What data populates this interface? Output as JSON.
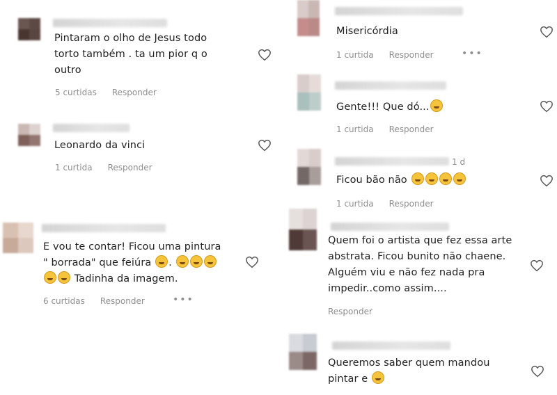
{
  "colors": {
    "meta": "#8e8e8e",
    "text": "#262626",
    "emoji": "#f5c43b"
  },
  "icons": {
    "like": "heart-icon",
    "more": "more-options-icon"
  },
  "left_comments": [
    {
      "lines": [
        "Pintaram o olho de Jesus todo",
        "torto também . ta um pior q o",
        "outro"
      ],
      "likes": "5 curtidas",
      "reply": "Responder"
    },
    {
      "lines": [
        "Leonardo da vinci"
      ],
      "likes": "1 curtida",
      "reply": "Responder"
    },
    {
      "lines": [
        "E vou te contar! Ficou uma pintura",
        "\" borrada\" que feiúra",
        "Tadinha da imagem."
      ],
      "likes": "6 curtidas",
      "reply": "Responder",
      "more": "•••"
    }
  ],
  "right_comments": [
    {
      "lines": [
        "Misericórdia"
      ],
      "likes": "1 curtida",
      "reply": "Responder",
      "more": "•••"
    },
    {
      "lines": [
        "Gente!!! Que dó..."
      ],
      "likes": "1 curtida",
      "reply": "Responder"
    },
    {
      "time": "1 d",
      "lines": [
        "Ficou bão não"
      ],
      "likes": "1 curtida",
      "reply": "Responder"
    },
    {
      "lines": [
        "Quem foi o artista que fez essa arte",
        "abstrata. Ficou bunito não chaene.",
        "Alguém viu e não fez nada pra",
        "impedir..como assim...."
      ],
      "reply": "Responder"
    },
    {
      "lines": [
        "Queremos saber quem mandou",
        "pintar e"
      ]
    }
  ]
}
